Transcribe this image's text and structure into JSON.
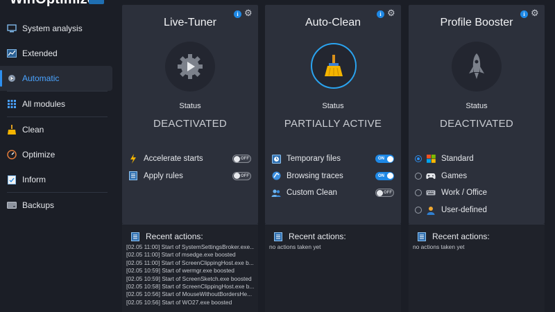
{
  "app": {
    "title": "WinOptimizer"
  },
  "sidebar": {
    "items": [
      {
        "label": "System analysis",
        "icon": "monitor-icon"
      },
      {
        "label": "Extended",
        "icon": "chart-icon"
      },
      {
        "label": "Automatic",
        "icon": "automatic-gear-icon",
        "active": true
      },
      {
        "label": "All modules",
        "icon": "grid-icon"
      },
      {
        "label": "Clean",
        "icon": "broom-icon"
      },
      {
        "label": "Optimize",
        "icon": "gauge-icon"
      },
      {
        "label": "Inform",
        "icon": "clipboard-icon"
      },
      {
        "label": "Backups",
        "icon": "drive-icon"
      }
    ]
  },
  "panels": {
    "live_tuner": {
      "title": "Live-Tuner",
      "status_label": "Status",
      "status_value": "DEACTIVATED",
      "options": [
        {
          "label": "Accelerate starts",
          "toggle": "OFF"
        },
        {
          "label": "Apply rules",
          "toggle": "OFF"
        }
      ]
    },
    "auto_clean": {
      "title": "Auto-Clean",
      "status_label": "Status",
      "status_value": "PARTIALLY ACTIVE",
      "options": [
        {
          "label": "Temporary files",
          "toggle": "ON"
        },
        {
          "label": "Browsing traces",
          "toggle": "ON"
        },
        {
          "label": "Custom Clean",
          "toggle": "OFF"
        }
      ]
    },
    "profile_booster": {
      "title": "Profile Booster",
      "status_label": "Status",
      "status_value": "DEACTIVATED",
      "options": [
        {
          "label": "Standard",
          "selected": true
        },
        {
          "label": "Games",
          "selected": false
        },
        {
          "label": "Work / Office",
          "selected": false
        },
        {
          "label": "User-defined",
          "selected": false
        }
      ]
    }
  },
  "recent": {
    "heading": "Recent actions:",
    "live_tuner": [
      "[02.05 11:00] Start of SystemSettingsBroker.exe...",
      "[02.05 11:00] Start of msedge.exe boosted",
      "[02.05 11:00] Start of ScreenClippingHost.exe b...",
      "[02.05 10:59] Start of wermgr.exe boosted",
      "[02.05 10:59] Start of ScreenSketch.exe boosted",
      "[02.05 10:58] Start of ScreenClippingHost.exe b...",
      "[02.05 10:56] Start of MouseWithoutBordersHe...",
      "[02.05 10:56] Start of WO27.exe boosted"
    ],
    "auto_clean": "no actions taken yet",
    "profile_booster": "no actions taken yet"
  },
  "colors": {
    "accent": "#2d8ff0",
    "toggle_on": "#1e88e5",
    "panel_bg": "#2c303b",
    "page_bg": "#1b1e26"
  }
}
